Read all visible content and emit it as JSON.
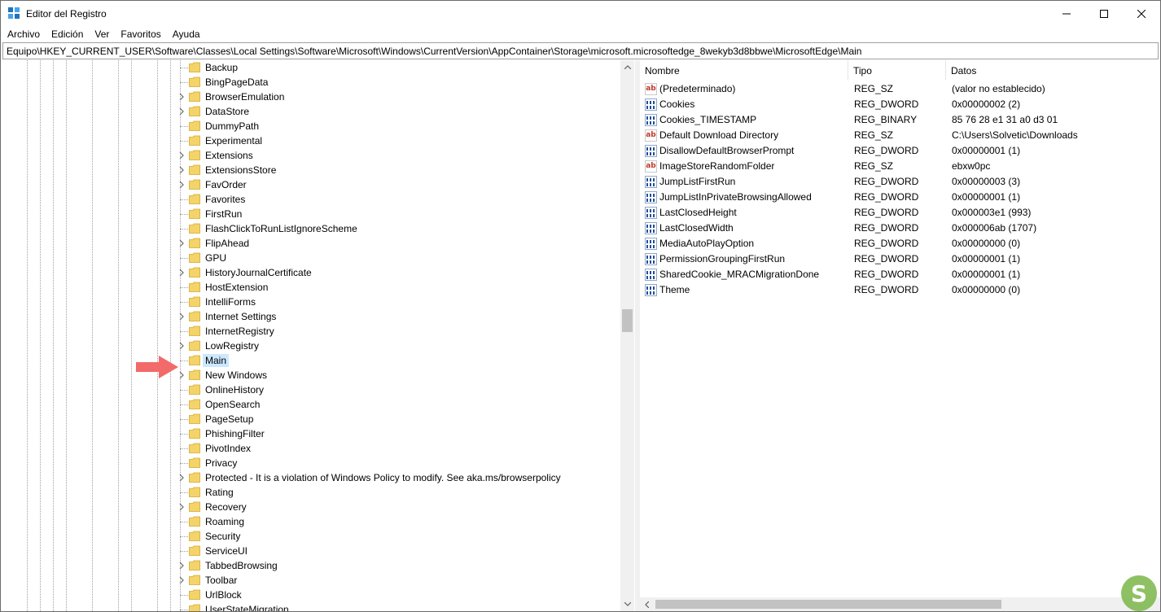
{
  "window": {
    "title": "Editor del Registro",
    "minimize_glyph": "—",
    "maximize_glyph": "☐",
    "close_glyph": "✕"
  },
  "menu": [
    "Archivo",
    "Edición",
    "Ver",
    "Favoritos",
    "Ayuda"
  ],
  "address": "Equipo\\HKEY_CURRENT_USER\\Software\\Classes\\Local Settings\\Software\\Microsoft\\Windows\\CurrentVersion\\AppContainer\\Storage\\microsoft.microsoftedge_8wekyb3d8bbwe\\MicrosoftEdge\\Main",
  "tree": {
    "items": [
      {
        "label": "Backup",
        "expandable": false
      },
      {
        "label": "BingPageData",
        "expandable": false
      },
      {
        "label": "BrowserEmulation",
        "expandable": true
      },
      {
        "label": "DataStore",
        "expandable": true
      },
      {
        "label": "DummyPath",
        "expandable": false
      },
      {
        "label": "Experimental",
        "expandable": false
      },
      {
        "label": "Extensions",
        "expandable": true
      },
      {
        "label": "ExtensionsStore",
        "expandable": true
      },
      {
        "label": "FavOrder",
        "expandable": true
      },
      {
        "label": "Favorites",
        "expandable": false
      },
      {
        "label": "FirstRun",
        "expandable": false
      },
      {
        "label": "FlashClickToRunListIgnoreScheme",
        "expandable": false
      },
      {
        "label": "FlipAhead",
        "expandable": true
      },
      {
        "label": "GPU",
        "expandable": false
      },
      {
        "label": "HistoryJournalCertificate",
        "expandable": true
      },
      {
        "label": "HostExtension",
        "expandable": false
      },
      {
        "label": "IntelliForms",
        "expandable": false
      },
      {
        "label": "Internet Settings",
        "expandable": true
      },
      {
        "label": "InternetRegistry",
        "expandable": false
      },
      {
        "label": "LowRegistry",
        "expandable": true
      },
      {
        "label": "Main",
        "expandable": false,
        "selected": true
      },
      {
        "label": "New Windows",
        "expandable": true
      },
      {
        "label": "OnlineHistory",
        "expandable": false
      },
      {
        "label": "OpenSearch",
        "expandable": false
      },
      {
        "label": "PageSetup",
        "expandable": false
      },
      {
        "label": "PhishingFilter",
        "expandable": false
      },
      {
        "label": "PivotIndex",
        "expandable": false
      },
      {
        "label": "Privacy",
        "expandable": false
      },
      {
        "label": "Protected - It is a violation of Windows Policy to modify. See aka.ms/browserpolicy",
        "expandable": true
      },
      {
        "label": "Rating",
        "expandable": false
      },
      {
        "label": "Recovery",
        "expandable": true
      },
      {
        "label": "Roaming",
        "expandable": false
      },
      {
        "label": "Security",
        "expandable": false
      },
      {
        "label": "ServiceUI",
        "expandable": false
      },
      {
        "label": "TabbedBrowsing",
        "expandable": true
      },
      {
        "label": "Toolbar",
        "expandable": true
      },
      {
        "label": "UrlBlock",
        "expandable": false
      },
      {
        "label": "UserStateMigration",
        "expandable": false
      }
    ]
  },
  "list": {
    "columns": {
      "name": "Nombre",
      "type": "Tipo",
      "data": "Datos"
    },
    "rows": [
      {
        "icon": "string-value-icon",
        "name": "(Predeterminado)",
        "type": "REG_SZ",
        "data": "(valor no establecido)"
      },
      {
        "icon": "binary-value-icon",
        "name": "Cookies",
        "type": "REG_DWORD",
        "data": "0x00000002 (2)"
      },
      {
        "icon": "binary-value-icon",
        "name": "Cookies_TIMESTAMP",
        "type": "REG_BINARY",
        "data": "85 76 28 e1 31 a0 d3 01"
      },
      {
        "icon": "string-value-icon",
        "name": "Default Download Directory",
        "type": "REG_SZ",
        "data": "C:\\Users\\Solvetic\\Downloads"
      },
      {
        "icon": "binary-value-icon",
        "name": "DisallowDefaultBrowserPrompt",
        "type": "REG_DWORD",
        "data": "0x00000001 (1)"
      },
      {
        "icon": "string-value-icon",
        "name": "ImageStoreRandomFolder",
        "type": "REG_SZ",
        "data": "ebxw0pc"
      },
      {
        "icon": "binary-value-icon",
        "name": "JumpListFirstRun",
        "type": "REG_DWORD",
        "data": "0x00000003 (3)"
      },
      {
        "icon": "binary-value-icon",
        "name": "JumpListInPrivateBrowsingAllowed",
        "type": "REG_DWORD",
        "data": "0x00000001 (1)"
      },
      {
        "icon": "binary-value-icon",
        "name": "LastClosedHeight",
        "type": "REG_DWORD",
        "data": "0x000003e1 (993)"
      },
      {
        "icon": "binary-value-icon",
        "name": "LastClosedWidth",
        "type": "REG_DWORD",
        "data": "0x000006ab (1707)"
      },
      {
        "icon": "binary-value-icon",
        "name": "MediaAutoPlayOption",
        "type": "REG_DWORD",
        "data": "0x00000000 (0)"
      },
      {
        "icon": "binary-value-icon",
        "name": "PermissionGroupingFirstRun",
        "type": "REG_DWORD",
        "data": "0x00000001 (1)"
      },
      {
        "icon": "binary-value-icon",
        "name": "SharedCookie_MRACMigrationDone",
        "type": "REG_DWORD",
        "data": "0x00000001 (1)"
      },
      {
        "icon": "binary-value-icon",
        "name": "Theme",
        "type": "REG_DWORD",
        "data": "0x00000000 (0)"
      }
    ]
  },
  "icons": {
    "string_glyph": "ab",
    "binary_glyph": "011\n110"
  },
  "colors": {
    "selection": "#cce8ff",
    "arrow": "#f26a6a",
    "folder": "#f5d36b"
  }
}
